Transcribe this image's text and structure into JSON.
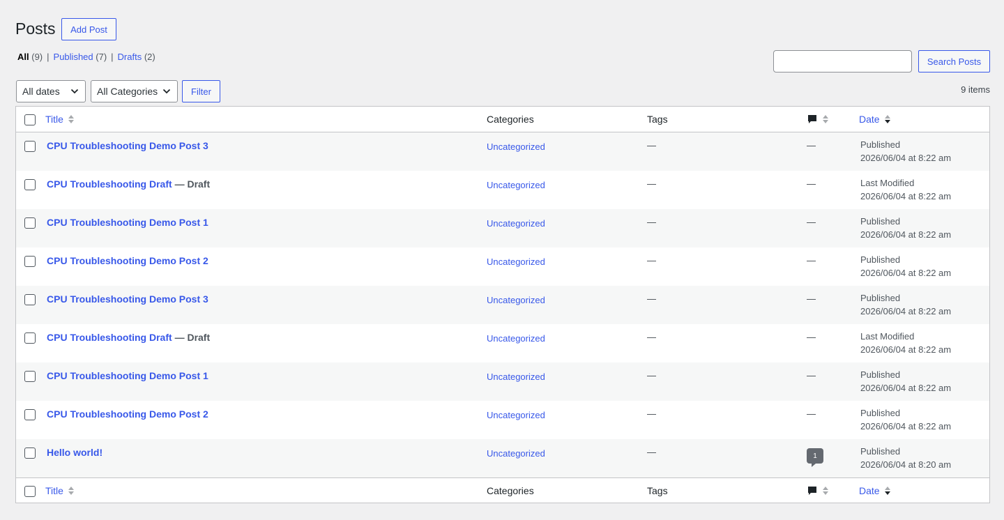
{
  "header": {
    "title": "Posts",
    "add_button": "Add Post"
  },
  "views": {
    "all_label": "All",
    "all_count": "(9)",
    "published_label": "Published",
    "published_count": "(7)",
    "drafts_label": "Drafts",
    "drafts_count": "(2)",
    "separator": "|"
  },
  "search": {
    "value": "",
    "button": "Search Posts"
  },
  "filters": {
    "dates": "All dates",
    "categories": "All Categories",
    "filter_button": "Filter",
    "items_count": "9 items"
  },
  "columns": {
    "title": "Title",
    "categories": "Categories",
    "tags": "Tags",
    "date": "Date"
  },
  "rows": [
    {
      "title": "CPU Troubleshooting Demo Post 3",
      "state": "",
      "category": "Uncategorized",
      "tags": "—",
      "comments": "—",
      "date_status": "Published",
      "date": "2026/06/04 at 8:22 am"
    },
    {
      "title": "CPU Troubleshooting Draft",
      "state": "— Draft",
      "category": "Uncategorized",
      "tags": "—",
      "comments": "—",
      "date_status": "Last Modified",
      "date": "2026/06/04 at 8:22 am"
    },
    {
      "title": "CPU Troubleshooting Demo Post 1",
      "state": "",
      "category": "Uncategorized",
      "tags": "—",
      "comments": "—",
      "date_status": "Published",
      "date": "2026/06/04 at 8:22 am"
    },
    {
      "title": "CPU Troubleshooting Demo Post 2",
      "state": "",
      "category": "Uncategorized",
      "tags": "—",
      "comments": "—",
      "date_status": "Published",
      "date": "2026/06/04 at 8:22 am"
    },
    {
      "title": "CPU Troubleshooting Demo Post 3",
      "state": "",
      "category": "Uncategorized",
      "tags": "—",
      "comments": "—",
      "date_status": "Published",
      "date": "2026/06/04 at 8:22 am"
    },
    {
      "title": "CPU Troubleshooting Draft",
      "state": "— Draft",
      "category": "Uncategorized",
      "tags": "—",
      "comments": "—",
      "date_status": "Last Modified",
      "date": "2026/06/04 at 8:22 am"
    },
    {
      "title": "CPU Troubleshooting Demo Post 1",
      "state": "",
      "category": "Uncategorized",
      "tags": "—",
      "comments": "—",
      "date_status": "Published",
      "date": "2026/06/04 at 8:22 am"
    },
    {
      "title": "CPU Troubleshooting Demo Post 2",
      "state": "",
      "category": "Uncategorized",
      "tags": "—",
      "comments": "—",
      "date_status": "Published",
      "date": "2026/06/04 at 8:22 am"
    },
    {
      "title": "Hello world!",
      "state": "",
      "category": "Uncategorized",
      "tags": "—",
      "comments": "1",
      "date_status": "Published",
      "date": "2026/06/04 at 8:20 am"
    }
  ],
  "icons": {
    "comments": "comment-bubble-icon",
    "sort": "sort-arrows-icon",
    "chevron": "chevron-down-icon"
  },
  "colors": {
    "accent": "#3858e9",
    "background": "#f0f0f1",
    "row_alt": "#f6f7f7"
  }
}
